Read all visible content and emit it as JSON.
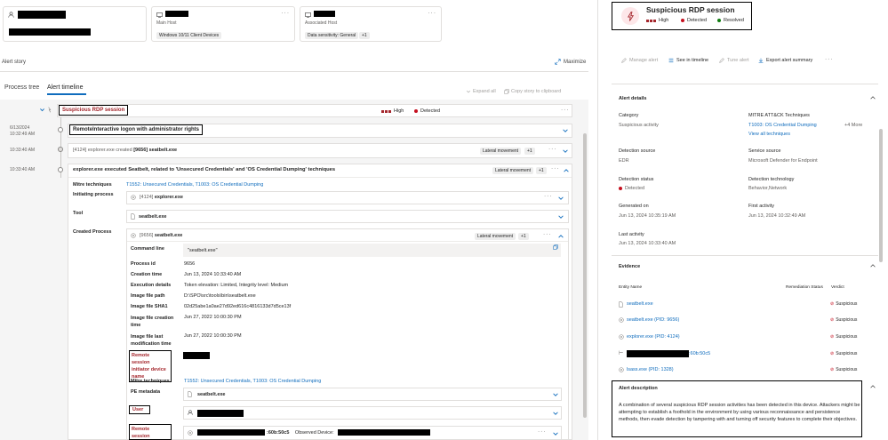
{
  "cards": {
    "card2_sub": "Main Host",
    "card2_tag": "Windows 10/11 Client Devices",
    "card3_sub": "Associated Host",
    "card3_tag": "Data sensitivity: General",
    "card3_plus": "+1"
  },
  "alert_story": "Alert story",
  "maximize": "Maximize",
  "tabs": [
    "Process tree",
    "Alert timeline"
  ],
  "toolbar": {
    "expand_all": "Expand all",
    "copy_story": "Copy story to clipboard"
  },
  "timeline": {
    "alert_title": "Suspicious RDP session",
    "high": "High",
    "detected": "Detected",
    "date": "6/13/2024",
    "time1": "10:32:49 AM",
    "row2_title": "RemoteInteractive logon with administrator rights",
    "time2": "10:33:40 AM",
    "row3_text_a": "[4124] explorer.exe created",
    "row3_text_b": "[9656] seatbelt.exe",
    "row3_tag": "Lateral movement",
    "row3_plus": "+1",
    "time3": "10:33:40 AM",
    "row4_title": "explorer.exe executed Seatbelt, related to 'Unsecured Credentials' and 'OS Credential Dumping' techniques",
    "row4_tag": "Lateral movement",
    "row4_plus": "+1",
    "mitre_label": "Mitre techniques",
    "mitre_value": "T1552: Unsecured Credentials, T1003: OS Credential Dumping",
    "init_label": "Initiating process",
    "init_pid": "[4124]",
    "init_name": "explorer.exe",
    "tool_label": "Tool",
    "tool_name": "seatbelt.exe",
    "created_label": "Created Process",
    "created_pid": "[9656]",
    "created_name": "seatbelt.exe",
    "created_tag": "Lateral movement",
    "created_plus": "+1",
    "details": {
      "cmd_label": "Command line",
      "cmd_value": "\"seatbelt.exe\"",
      "pid_label": "Process id",
      "pid_value": "9656",
      "ctime_label": "Creation time",
      "ctime_value": "Jun 13, 2024 10:33:40 AM",
      "exec_label": "Execution details",
      "exec_value": "Token elevation: Limited, Integrity level: Medium",
      "path_label": "Image file path",
      "path_value": "D:\\SPO\\src\\tools\\bin\\seatbelt.exe",
      "sha_label": "Image file SHA1",
      "sha_value": "02d25abe1a0ae27d92ed616c4816133d7d5ce13f",
      "fctime_label": "Image file creation time",
      "fctime_value": "Jun 27, 2022 10:00:30 PM",
      "fmtime_label": "Image file last modification time",
      "fmtime_value": "Jun 27, 2022 10:00:30 PM",
      "rsname_label": "Remote session initiator device name",
      "mitre2_label": "Mitre techniques",
      "mitre2_value": "T1552: Unsecured Credentials, T1003: OS Credential Dumping",
      "pe_label": "PE metadata",
      "pe_value": "seatbelt.exe",
      "user_label": "User",
      "rsip_label": "Remote session initiator IP",
      "rsip_value": ":60b:50c5",
      "observed": "Observed Device:"
    }
  },
  "right": {
    "title": "Suspicious RDP session",
    "high": "High",
    "detected": "Detected",
    "resolved": "Resolved",
    "actions": [
      "Manage alert",
      "See in timeline",
      "Tune alert",
      "Export alert summary"
    ],
    "details_header": "Alert details",
    "category_label": "Category",
    "category_value": "Suspicious activity",
    "mitre_label": "MITRE ATT&CK Techniques",
    "mitre_value": "T1003: OS Credential Dumping",
    "mitre_more": "+4 More",
    "view_all": "View all techniques",
    "dsource_label": "Detection source",
    "dsource_value": "EDR",
    "ssource_label": "Service source",
    "ssource_value": "Microsoft Defender for Endpoint",
    "dstatus_label": "Detection status",
    "dstatus_value": "Detected",
    "dtech_label": "Detection technology",
    "dtech_value": "Behavior,Network",
    "gen_label": "Generated on",
    "gen_value": "Jun 13, 2024 10:35:19 AM",
    "first_label": "First activity",
    "first_value": "Jun 13, 2024 10:32:49 AM",
    "last_label": "Last activity",
    "last_value": "Jun 13, 2024 10:33:40 AM",
    "evidence_header": "Evidence",
    "col_entity": "Entity Name",
    "col_remediation": "Remediation Status",
    "col_verdict": "Verdict",
    "evidence": [
      {
        "name": "seatbelt.exe",
        "verdict": "Suspicious"
      },
      {
        "name": "seatbelt.exe (PID: 9656)",
        "verdict": "Suspicious"
      },
      {
        "name": "explorer.exe (PID: 4124)",
        "verdict": "Suspicious"
      },
      {
        "name": ":60b:50c5",
        "verdict": "Suspicious"
      },
      {
        "name": "lsass.exe (PID: 1328)",
        "verdict": "Suspicious"
      }
    ],
    "desc_header": "Alert description",
    "desc_text": "A combination of several suspicious RDP session activities has been detected in this device. Attackers might be attempting to establish a foothold in the environment by using various reconnaissance and persistence methods, then evade detection by tampering with and turning off security features to complete their objectives."
  }
}
